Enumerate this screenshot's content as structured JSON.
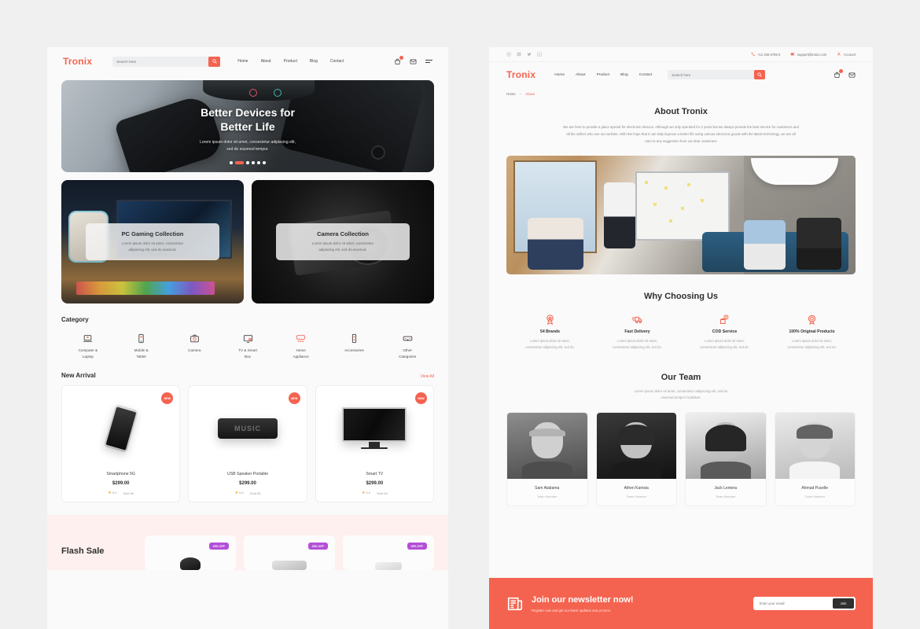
{
  "brand": {
    "name": "Tronix",
    "accent": "#f4634f",
    "dark": "#2e2e2e",
    "purple": "#b34fd6"
  },
  "home": {
    "header": {
      "logo": "Tronix",
      "search_placeholder": "Search here",
      "search_value": "",
      "nav": [
        {
          "label": "Home"
        },
        {
          "label": "About"
        },
        {
          "label": "Product"
        },
        {
          "label": "Blog"
        },
        {
          "label": "Contact"
        }
      ],
      "icons": [
        {
          "name": "cart-icon",
          "badge": ""
        },
        {
          "name": "mail-icon"
        },
        {
          "name": "menu-icon"
        }
      ]
    },
    "hero": {
      "title_line1": "Better Devices for",
      "title_line2": "Better Life",
      "subtitle_line1": "Lorem ipsum dolor sit amet, consectetur adipiscing elit,",
      "subtitle_line2": "sed do eiusmod tempor.",
      "dots_total": 6,
      "dots_active_index": 1
    },
    "collections": [
      {
        "title": "PC Gaming Collection",
        "desc_line1": "Lorem ipsum dolor sit amet, consectetur",
        "desc_line2": "adipiscing elit, sed do eiusmod."
      },
      {
        "title": "Camera Collection",
        "desc_line1": "Lorem ipsum dolor sit amet, consectetur",
        "desc_line2": "adipiscing elit, sed do eiusmod."
      }
    ],
    "category": {
      "title": "Category",
      "items": [
        {
          "label_line1": "Computer &",
          "label_line2": "Laptop",
          "icon": "laptop-icon"
        },
        {
          "label_line1": "Mobile &",
          "label_line2": "Tablet",
          "icon": "mobile-icon"
        },
        {
          "label_line1": "Camera",
          "label_line2": "",
          "icon": "camera-icon"
        },
        {
          "label_line1": "TV & Smart",
          "label_line2": "Box",
          "icon": "tv-icon"
        },
        {
          "label_line1": "Home",
          "label_line2": "Appliance",
          "icon": "appliance-icon"
        },
        {
          "label_line1": "Accessories",
          "label_line2": "",
          "icon": "accessories-icon"
        },
        {
          "label_line1": "Other",
          "label_line2": "Categories",
          "icon": "vr-icon"
        }
      ]
    },
    "new_arrival": {
      "title": "New Arrival",
      "view_all": "View All",
      "products": [
        {
          "name": "Smartphone 5G",
          "price": "$299.00",
          "badge": "NEW",
          "rating": "5.0",
          "sold": "Sold 99"
        },
        {
          "name": "USB Speaker Portable",
          "price": "$299.00",
          "badge": "NEW",
          "rating": "5.0",
          "sold": "Sold 99",
          "art_label": "MUSIC"
        },
        {
          "name": "Smart TV",
          "price": "$299.00",
          "badge": "NEW",
          "rating": "5.0",
          "sold": "Sold 99"
        }
      ]
    },
    "flash_sale": {
      "title": "Flash Sale",
      "cards": [
        {
          "discount": "25% OFF"
        },
        {
          "discount": "25% OFF"
        },
        {
          "discount": "25% OFF"
        }
      ]
    }
  },
  "about": {
    "topbar": {
      "socials": [
        {
          "name": "instagram-icon"
        },
        {
          "name": "facebook-icon"
        },
        {
          "name": "twitter-icon"
        },
        {
          "name": "linkedin-icon"
        }
      ],
      "phone": "+12 345 6789 0",
      "email": "support@tronix.com",
      "account": "Account"
    },
    "header": {
      "logo": "Tronix",
      "nav": [
        {
          "label": "Home"
        },
        {
          "label": "About"
        },
        {
          "label": "Product"
        },
        {
          "label": "Blog"
        },
        {
          "label": "Contact"
        }
      ],
      "search_placeholder": "Search here",
      "search_value": ""
    },
    "breadcrumb": {
      "home": "Home",
      "separator": ">",
      "current": "About"
    },
    "intro": {
      "title": "About Tronix",
      "paragraph_line1": "We are here to provide a place special for electronic devices. Although we only operated for 2 years but we always",
      "paragraph_line2": "provide the best service for customers and all the sellers who use our website. With the hope that it can help improve",
      "paragraph_line3": "a better life using various electronic goods with the latest technology, we are all ears to any suggestion from our dear",
      "paragraph_line4": "customers"
    },
    "why": {
      "title": "Why Choosing Us",
      "items": [
        {
          "name": "54 Brands",
          "icon": "badge-star-icon",
          "desc_line1": "Lorem ipsum dolor sit amet,",
          "desc_line2": "consectetur adipiscing elit, sed do."
        },
        {
          "name": "Fast Delivery",
          "icon": "truck-icon",
          "desc_line1": "Lorem ipsum dolor sit amet,",
          "desc_line2": "consectetur adipiscing elit, sed do."
        },
        {
          "name": "COD Service",
          "icon": "cash-box-icon",
          "desc_line1": "Lorem ipsum dolor sit amet,",
          "desc_line2": "consectetur adipiscing elit, sed do."
        },
        {
          "name": "100% Original Products",
          "icon": "award-icon",
          "desc_line1": "Lorem ipsum dolor sit amet,",
          "desc_line2": "consectetur adipiscing elit, sed do."
        }
      ]
    },
    "team": {
      "title": "Our Team",
      "subtitle_line1": "Lorem ipsum dolor sit amet, consectetur adipiscing elit, sed do",
      "subtitle_line2": "eiusmod tempor incididunt.",
      "members": [
        {
          "name": "Sam Alabama",
          "role": "Team Member"
        },
        {
          "name": "Athen Kamsia",
          "role": "Team Member"
        },
        {
          "name": "Jack Lentera",
          "role": "Team Member"
        },
        {
          "name": "Ahmad Pucelle",
          "role": "Team Member"
        }
      ]
    },
    "newsletter": {
      "icon": "newspaper-icon",
      "title": "Join our newsletter now!",
      "subtitle": "Register now and get our latest updates and promos.",
      "input_placeholder": "Enter your email",
      "input_value": "",
      "button": "Join"
    }
  }
}
